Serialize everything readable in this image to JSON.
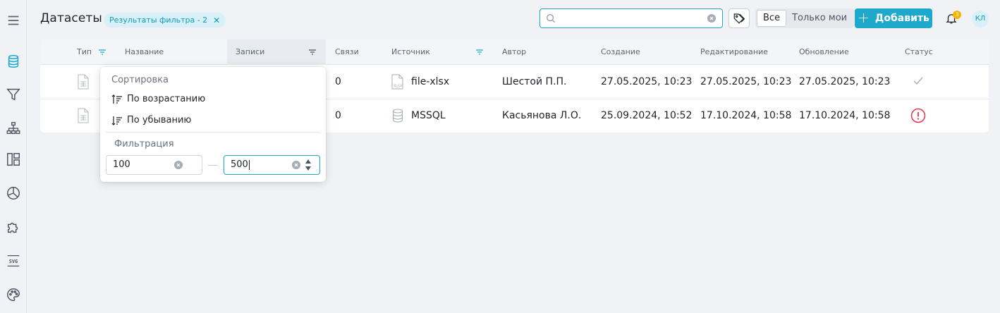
{
  "app": {
    "title": "Датасеты",
    "filter_chip": "Результаты фильтра - 2",
    "search": {
      "value": "",
      "placeholder": ""
    },
    "scope_toggle": {
      "all": "Все",
      "mine": "Только мои",
      "selected": "all"
    },
    "add_button": "Добавить",
    "notifications_count": "3",
    "user_initials": "КЛ",
    "accent": "#1ea9cc"
  },
  "sidebar": {
    "icons": [
      "menu-icon",
      "database-icon",
      "filter-icon",
      "hierarchy-icon",
      "dashboard-layout-icon",
      "pie-chart-icon",
      "puzzle-icon",
      "svg-icon",
      "palette-icon"
    ],
    "active": "database-icon"
  },
  "table": {
    "columns": [
      "Тип",
      "Название",
      "Записи",
      "Связи",
      "Источник",
      "Автор",
      "Создание",
      "Редактирование",
      "Обновление",
      "Статус"
    ],
    "rows": [
      {
        "links": "0",
        "source": "file-xlsx",
        "source_icon": "xlsx-file-icon",
        "author": "Шестой П.П.",
        "created": "27.05.2025, 10:23",
        "edited": "27.05.2025, 10:23",
        "updated": "27.05.2025, 10:23",
        "status": "ok"
      },
      {
        "links": "0",
        "source": "MSSQL",
        "source_icon": "database-icon",
        "author": "Касьянова Л.О.",
        "created": "25.09.2024, 10:52",
        "edited": "17.10.2024, 10:58",
        "updated": "17.10.2024, 10:58",
        "status": "error"
      }
    ]
  },
  "column_popup": {
    "sort_title": "Сортировка",
    "sort_asc": "По возрастанию",
    "sort_desc": "По убыванию",
    "filter_title": "Фильтрация",
    "from_value": "100",
    "to_value": "500"
  }
}
